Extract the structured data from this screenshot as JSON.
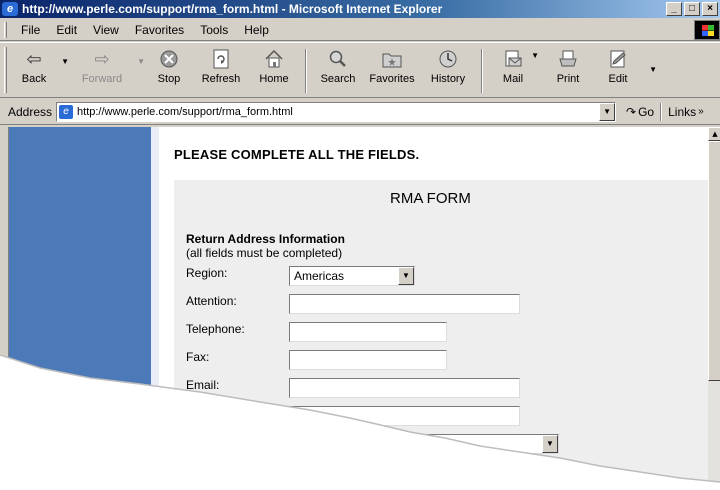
{
  "window": {
    "title": "http://www.perle.com/support/rma_form.html - Microsoft Internet Explorer",
    "controls": [
      "_",
      "□",
      "×"
    ]
  },
  "menu": [
    "File",
    "Edit",
    "View",
    "Favorites",
    "Tools",
    "Help"
  ],
  "toolbar": {
    "back": "Back",
    "forward": "Forward",
    "stop": "Stop",
    "refresh": "Refresh",
    "home": "Home",
    "search": "Search",
    "favorites": "Favorites",
    "history": "History",
    "mail": "Mail",
    "print": "Print",
    "edit": "Edit"
  },
  "address": {
    "label": "Address",
    "url": "http://www.perle.com/support/rma_form.html",
    "go": "Go",
    "links": "Links"
  },
  "page": {
    "notice": "PLEASE COMPLETE ALL THE FIELDS.",
    "form_title": "RMA FORM",
    "section_title": "Return Address Information",
    "section_sub": "(all fields must be completed)",
    "fields": {
      "region_label": "Region:",
      "region_value": "Americas",
      "attention_label": "Attention:",
      "telephone_label": "Telephone:",
      "fax_label": "Fax:",
      "email_label": "Email:"
    }
  },
  "colors": {
    "title_bar": "#0a246a",
    "chrome": "#d4d0c8",
    "left_column": "#4c79b7",
    "form_panel": "#eeeeee"
  }
}
